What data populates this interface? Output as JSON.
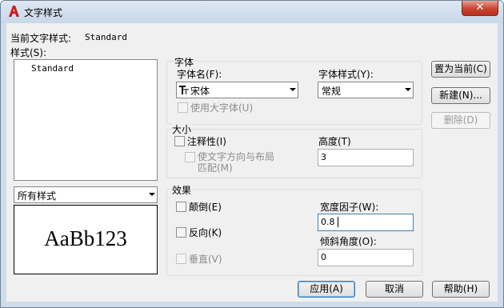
{
  "title": "文字样式",
  "close_label": "✕",
  "current_style": {
    "label": "当前文字样式:",
    "value": "Standard"
  },
  "styles_label": "样式(S):",
  "styles_list": [
    "Standard"
  ],
  "filter": {
    "value": "所有样式"
  },
  "preview_text": "AaBb123",
  "font_group": {
    "title": "字体",
    "font_name_label": "字体名(F):",
    "font_name_value": "宋体",
    "font_icon": "truetype-font-icon",
    "font_style_label": "字体样式(Y):",
    "font_style_value": "常规",
    "big_font_label": "使用大字体(U)"
  },
  "size_group": {
    "title": "大小",
    "annotative_label": "注释性(I)",
    "match_orientation_line1": "使文字方向与布局",
    "match_orientation_line2": "匹配(M)",
    "height_label": "高度(T)",
    "height_value": "3"
  },
  "effects_group": {
    "title": "效果",
    "upside_down_label": "颠倒(E)",
    "backwards_label": "反向(K)",
    "vertical_label": "垂直(V)",
    "width_factor_label": "宽度因子(W):",
    "width_factor_value": "0.8",
    "oblique_label": "倾斜角度(O):",
    "oblique_value": "0"
  },
  "buttons": {
    "set_current": "置为当前(C)",
    "new": "新建(N)...",
    "delete": "删除(D)",
    "apply": "应用(A)",
    "cancel": "取消",
    "help": "帮助(H)"
  },
  "colors": {
    "app_icon": "#c81e1e",
    "close": "#c7432f"
  }
}
